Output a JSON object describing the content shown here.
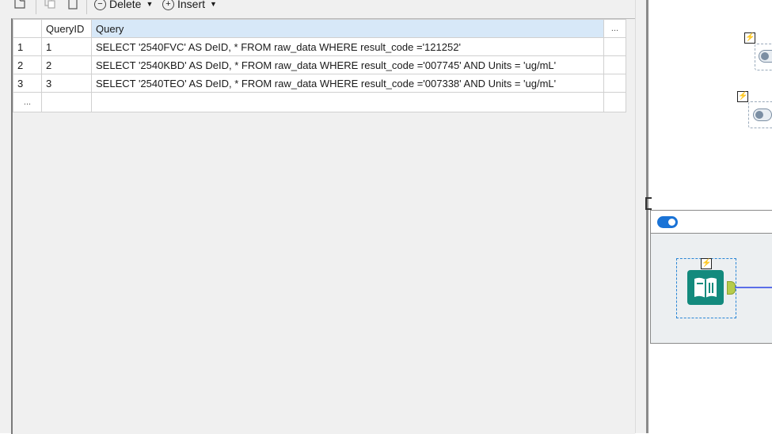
{
  "toolbar": {
    "delete_label": "Delete",
    "insert_label": "Insert"
  },
  "grid": {
    "columns": [
      "QueryID",
      "Query"
    ],
    "more_glyph": "...",
    "new_row_glyph": "...",
    "rows": [
      {
        "num": "1",
        "query_id": "1",
        "query": "SELECT '2540FVC' AS DeID, * FROM raw_data WHERE result_code ='121252'"
      },
      {
        "num": "2",
        "query_id": "2",
        "query": "SELECT '2540KBD' AS DeID, * FROM raw_data WHERE result_code ='007745' AND Units =  'ug/mL'"
      },
      {
        "num": "3",
        "query_id": "3",
        "query": "SELECT '2540TEO' AS DeID, * FROM raw_data WHERE result_code ='007338' AND Units =  'ug/mL'"
      }
    ]
  },
  "canvas": {
    "bolt_glyph": "⚡",
    "colors": {
      "tool": "#138a7d",
      "toggle_on": "#1a73d6",
      "connection": "#5a6ee8",
      "anchor": "#b6cc4a"
    }
  }
}
